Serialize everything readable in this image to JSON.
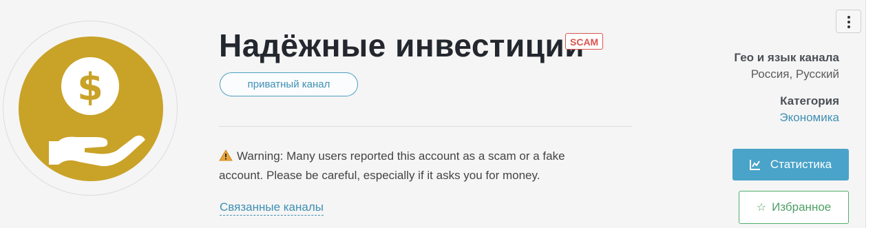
{
  "channel": {
    "title": "Надёжные инвестиции",
    "badge": "SCAM",
    "privacy": "приватный канал",
    "avatar_icon": "dollar-hand-icon",
    "avatar_color": "#c9a228"
  },
  "warning": {
    "icon": "warning-icon",
    "text": "Warning: Many users reported this account as a scam or a fake account. Please be careful, especially if it asks you for money."
  },
  "related_link": "Связанные каналы",
  "sidebar": {
    "geo_label": "Гео и язык канала",
    "geo_value": "Россия, Русский",
    "category_label": "Категория",
    "category_value": "Экономика",
    "stats_button": "Статистика",
    "stats_icon": "line-chart-icon",
    "fav_button": "Избранное",
    "fav_icon": "star-icon"
  },
  "menu_icon": "kebab-menu-icon",
  "colors": {
    "accent": "#4aa3c9",
    "scam": "#d9534f",
    "favorite": "#4eae6e"
  }
}
